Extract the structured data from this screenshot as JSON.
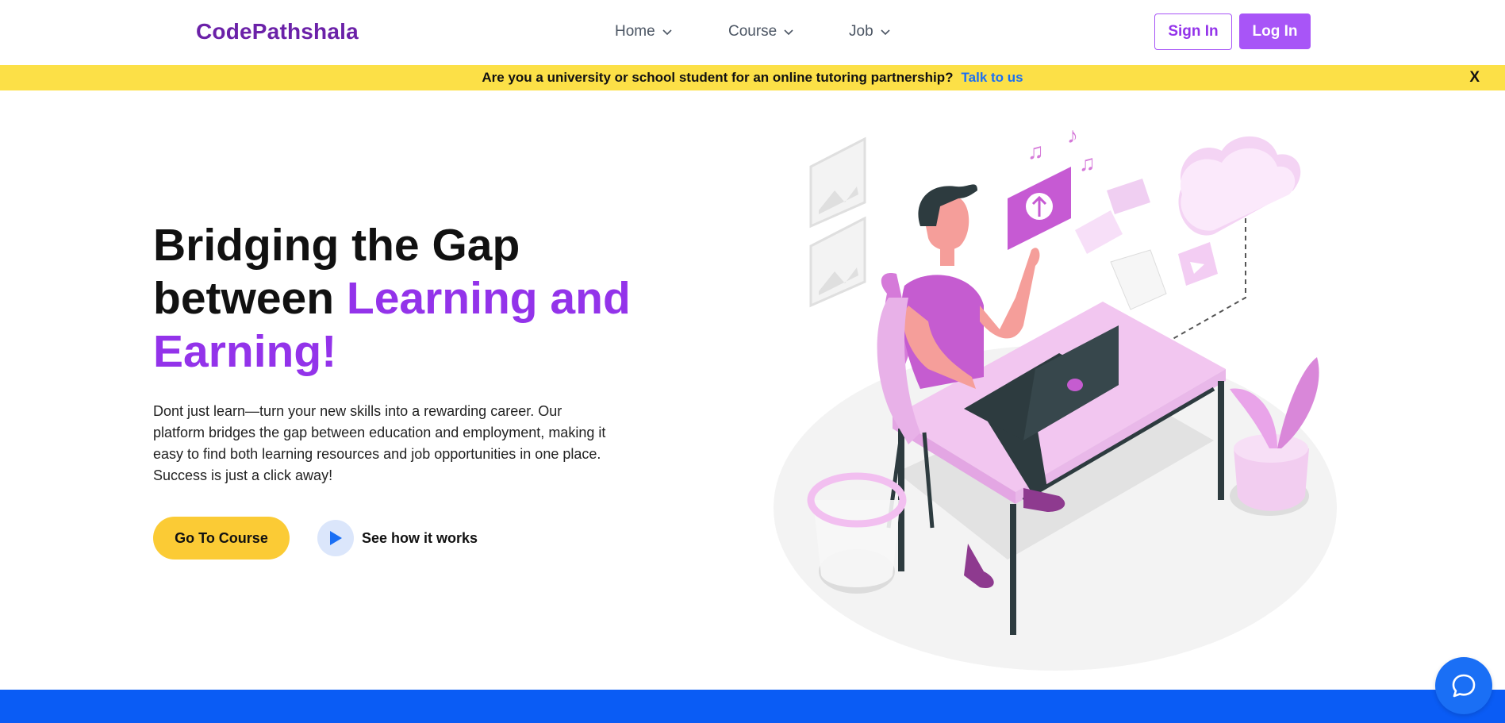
{
  "header": {
    "logo": "CodePathshala",
    "nav": [
      {
        "label": "Home"
      },
      {
        "label": "Course"
      },
      {
        "label": "Job"
      }
    ],
    "sign_in_label": "Sign In",
    "log_in_label": "Log In"
  },
  "banner": {
    "text": "Are you a university or school student for an online tutoring partnership?",
    "link": "Talk to us",
    "close": "X"
  },
  "hero": {
    "title_line1": "Bridging the Gap",
    "title_line2_plain": "between ",
    "title_line2_accent": "Learning and",
    "title_line3_accent": "Earning!",
    "description": "Dont just learn—turn your new skills into a rewarding career. Our platform bridges the gap between education and employment, making it easy to find both learning resources and job opportunities in one place. Success is just a click away!",
    "primary_button": "Go To Course",
    "secondary_button": "See how it works"
  },
  "icons": {
    "chevron": "chevron-down-icon",
    "play": "play-icon",
    "chat": "chat-bubble-icon"
  },
  "colors": {
    "brand_purple": "#6b21a8",
    "accent_purple": "#9333ea",
    "button_purple": "#a855f7",
    "banner_yellow": "#fce047",
    "cta_yellow": "#fbcb35",
    "link_blue": "#1a6ff5",
    "footer_blue": "#0a5cf5"
  }
}
